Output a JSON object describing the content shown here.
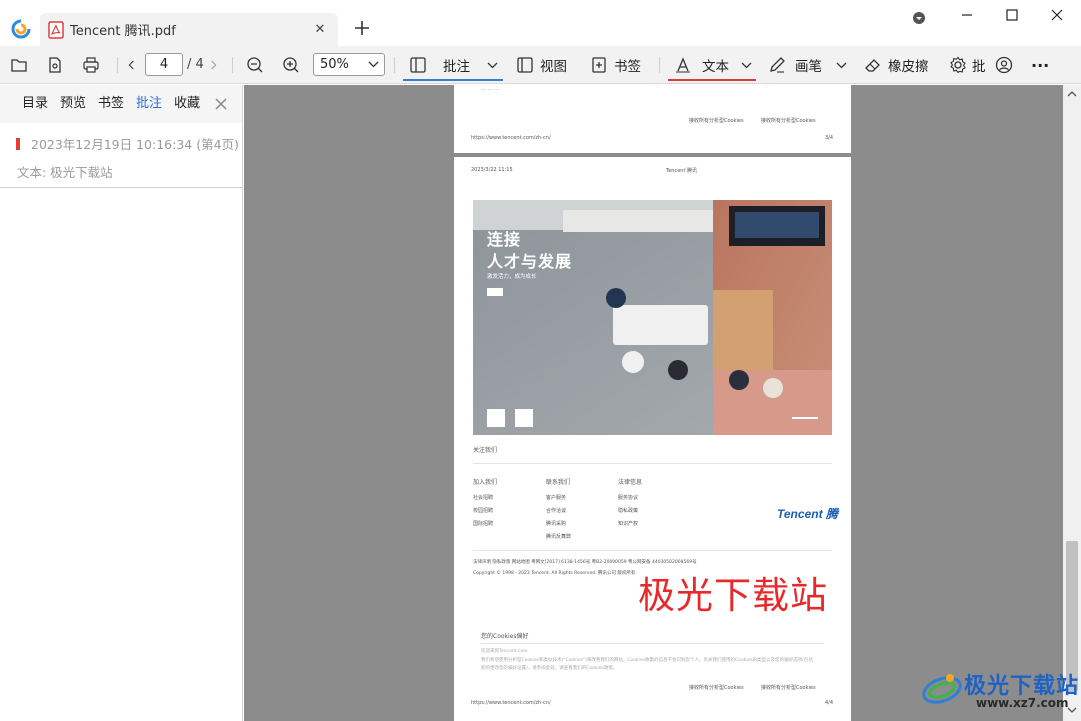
{
  "window": {
    "tab_title": "Tencent 腾讯.pdf",
    "controls": [
      "dropdown",
      "minimize",
      "maximize",
      "close"
    ]
  },
  "toolbar": {
    "current_page": "4",
    "total_pages": "/ 4",
    "zoom": "50%",
    "annotate_label": "批注",
    "view_label": "视图",
    "bookmark_label": "书签",
    "text_label": "文本",
    "pen_label": "画笔",
    "eraser_label": "橡皮擦",
    "batch_label": "批",
    "more_label": "···"
  },
  "sidebar": {
    "tabs": [
      "目录",
      "预览",
      "书签",
      "批注",
      "收藏"
    ],
    "active_tab": "批注",
    "annotation": {
      "time": "2023年12月19日 10:16:34 (第4页)",
      "text": "文本: 极光下载站"
    }
  },
  "document": {
    "page3": {
      "footer_url": "https://www.tencent.com/zh-cn/",
      "footer_page": "3/4",
      "links": [
        "接收所有分析型Cookies",
        "接收所有分析型Cookies"
      ]
    },
    "page4": {
      "header_date": "2023/3/22 11:15",
      "header_title": "Tencent 腾讯",
      "hero_title1": "连接",
      "hero_title2": "人才与发展",
      "hero_sub": "激发活力，成为成长",
      "follow_us": "关注我们",
      "columns": [
        {
          "heading": "加入我们",
          "items": [
            "社会招聘",
            "校园招聘",
            "国际招聘"
          ]
        },
        {
          "heading": "联系我们",
          "items": [
            "客户服务",
            "合作洽谈",
            "腾讯采购",
            "腾讯反舞弊"
          ]
        },
        {
          "heading": "法律信息",
          "items": [
            "服务协议",
            "隐私政策",
            "知识产权"
          ]
        }
      ],
      "brand": "Tencent 腾",
      "legal_line": "法律声明  隐私政策  网站地图  粤网文[2017] 6138-1456号  粤B2-20090059  粤公网安备 44030502008569号",
      "copyright": "Copyright © 1998 - 2023 Tencent. All Rights Reserved. 腾讯公司 版权所有",
      "annotation_text": "极光下载站",
      "cookie_title": "您的Cookies偏好",
      "cookie_welcome": "欢迎来到Tencent.com",
      "cookie_body1": "我们希望使用分析型Cookies和类似技术(\"Cookies\")来改善我们的网站。Cookies收集的信息不会识别您个人。有关我们使用的Cookies的类型以及您的偏好选项(包括",
      "cookie_body2": "如何更改您的偏好设置)，请参阅此处。请查看我们的Cookies政策。",
      "links": [
        "接收所有分析型Cookies",
        "接收所有分析型Cookies"
      ],
      "footer_url": "https://www.tencent.com/zh-cn/",
      "footer_page": "4/4"
    }
  },
  "site_watermark": {
    "name": "极光下载站",
    "url": "www.xz7.com"
  },
  "colors": {
    "accent_blue": "#2f6fd6",
    "accent_red": "#e33b3b",
    "doc_bg": "#8c8c8c"
  }
}
